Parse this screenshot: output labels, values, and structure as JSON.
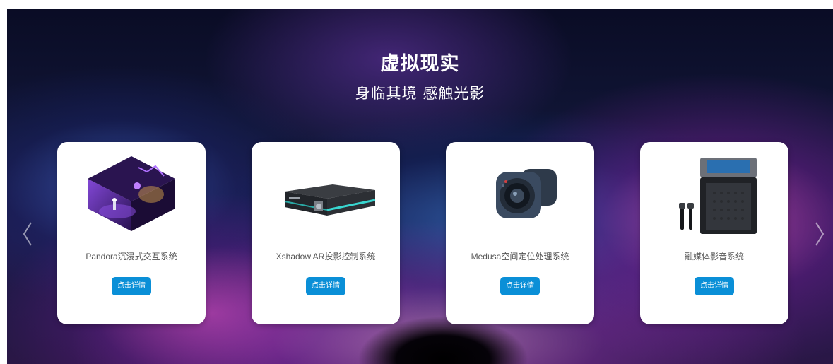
{
  "banner": {
    "title": "虚拟现实",
    "subtitle": "身临其境 感触光影"
  },
  "nav": {
    "prev_icon": "chevron-left-icon",
    "next_icon": "chevron-right-icon"
  },
  "products": [
    {
      "name": "Pandora沉浸式交互系统",
      "button_label": "点击详情",
      "image": "immersive-room-image"
    },
    {
      "name": "Xshadow AR投影控制系统",
      "button_label": "点击详情",
      "image": "ar-projection-device-image"
    },
    {
      "name": "Medusa空间定位处理系统",
      "button_label": "点击详情",
      "image": "positioning-camera-image"
    },
    {
      "name": "融媒体影音系统",
      "button_label": "点击详情",
      "image": "media-speaker-image"
    }
  ],
  "colors": {
    "button": "#0a8fd7",
    "card": "#ffffff",
    "accent_glow": "#38d6d0"
  }
}
